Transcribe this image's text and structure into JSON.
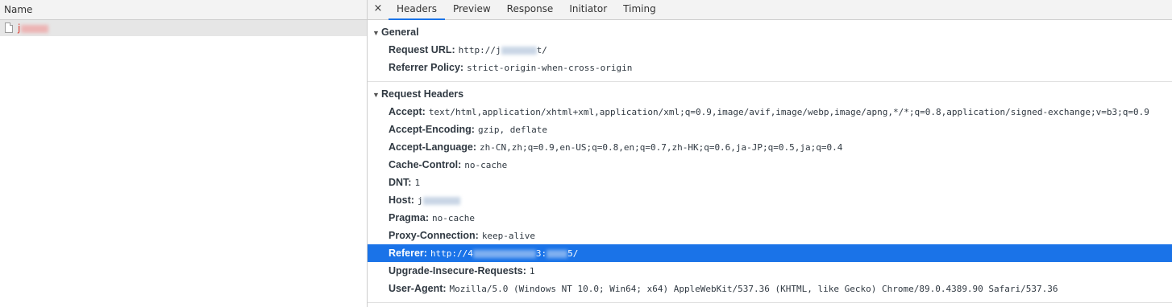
{
  "left": {
    "column_header": "Name",
    "request": {
      "name": "j",
      "selected": true
    }
  },
  "tabs": {
    "close_glyph": "×",
    "items": [
      "Headers",
      "Preview",
      "Response",
      "Initiator",
      "Timing"
    ],
    "active": "Headers"
  },
  "general": {
    "title": "General",
    "request_url_key": "Request URL:",
    "request_url_val_a": "http://j",
    "request_url_val_b": "t/",
    "referrer_policy_key": "Referrer Policy:",
    "referrer_policy_val": "strict-origin-when-cross-origin"
  },
  "request_headers": {
    "title": "Request Headers",
    "accept_key": "Accept:",
    "accept_val": "text/html,application/xhtml+xml,application/xml;q=0.9,image/avif,image/webp,image/apng,*/*;q=0.8,application/signed-exchange;v=b3;q=0.9",
    "encoding_key": "Accept-Encoding:",
    "encoding_val": "gzip, deflate",
    "language_key": "Accept-Language:",
    "language_val": "zh-CN,zh;q=0.9,en-US;q=0.8,en;q=0.7,zh-HK;q=0.6,ja-JP;q=0.5,ja;q=0.4",
    "cache_key": "Cache-Control:",
    "cache_val": "no-cache",
    "dnt_key": "DNT:",
    "dnt_val": "1",
    "host_key": "Host:",
    "host_val": "j",
    "pragma_key": "Pragma:",
    "pragma_val": "no-cache",
    "proxy_key": "Proxy-Connection:",
    "proxy_val": "keep-alive",
    "referer_key": "Referer:",
    "referer_val_a": "http://4",
    "referer_val_b": "3:",
    "referer_val_c": "5/",
    "upgrade_key": "Upgrade-Insecure-Requests:",
    "upgrade_val": "1",
    "ua_key": "User-Agent:",
    "ua_val": "Mozilla/5.0 (Windows NT 10.0; Win64; x64) AppleWebKit/537.36 (KHTML, like Gecko) Chrome/89.0.4389.90 Safari/537.36"
  },
  "colors": {
    "accent": "#1a73e8",
    "selected_row_bg": "#1a73e8"
  }
}
